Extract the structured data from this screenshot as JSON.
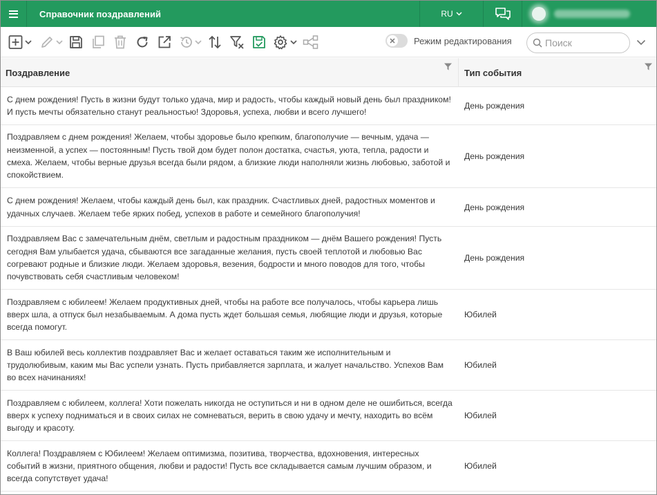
{
  "app": {
    "title": "Справочник поздравлений",
    "language": "RU",
    "accent_color": "#239a5e"
  },
  "toolbar": {
    "icons": [
      "add-icon",
      "edit-icon",
      "save-icon",
      "copy-icon",
      "delete-icon",
      "refresh-icon",
      "open-external-icon",
      "history-icon",
      "sort-icon",
      "clear-filter-icon",
      "save-check-icon",
      "settings-icon",
      "share-icon"
    ],
    "edit_mode_label": "Режим редактирования",
    "search_placeholder": "Поиск"
  },
  "table": {
    "columns": [
      "Поздравление",
      "Тип события"
    ],
    "rows": [
      {
        "text": "С днем рождения! Пусть в жизни будут только удача, мир и радость, чтобы каждый новый день был праздником! И пусть мечты обязательно станут реальностью! Здоровья, успеха, любви и всего лучшего!",
        "type": "День рождения"
      },
      {
        "text": "Поздравляем с днем рождения! Желаем, чтобы здоровье было крепким, благополучие — вечным, удача — неизменной, а успех — постоянным! Пусть твой дом будет полон достатка, счастья, уюта, тепла, радости и смеха. Желаем, чтобы верные друзья всегда были рядом, а близкие люди наполняли жизнь любовью, заботой и спокойствием.",
        "type": "День рождения"
      },
      {
        "text": "С днем рождения! Желаем, чтобы каждый день был, как праздник. Счастливых дней, радостных моментов и удачных случаев. Желаем тебе ярких побед, успехов в работе и семейного благополучия!",
        "type": "День рождения"
      },
      {
        "text": "Поздравляем Вас с замечательным днём, светлым и радостным праздником — днём Вашего рождения! Пусть сегодня Вам улыбается удача, сбываются все загаданные желания, пусть своей теплотой и любовью Вас согревают родные и близкие люди. Желаем здоровья, везения, бодрости и много поводов для того, чтобы почувствовать себя счастливым человеком!",
        "type": "День рождения"
      },
      {
        "text": "Поздравляем с юбилеем! Желаем продуктивных дней, чтобы на работе все получалось, чтобы карьера лишь вверх шла, а отпуск был незабываемым. А дома пусть ждет большая семья, любящие люди и друзья, которые всегда помогут.",
        "type": "Юбилей"
      },
      {
        "text": "В Ваш юбилей весь коллектив поздравляет Вас и желает оставаться таким же исполнительным и трудолюбивым, каким мы Вас успели узнать. Пусть прибавляется зарплата, и жалует начальство. Успехов Вам во всех начинаниях!",
        "type": "Юбилей"
      },
      {
        "text": "Поздравляем с юбилеем, коллега! Хоти пожелать никогда не оступиться и ни в одном деле не ошибиться, всегда вверх к успеху подниматься и в своих силах не сомневаться, верить в свою удачу и мечту, находить во всём выгоду и красоту.",
        "type": "Юбилей"
      },
      {
        "text": "Коллега! Поздравляем с Юбилеем! Желаем оптимизма, позитива, творчества, вдохновения, интересных событий в жизни, приятного общения, любви и радости! Пусть все складывается самым лучшим образом, и всегда сопутствует удача!",
        "type": "Юбилей"
      }
    ]
  }
}
